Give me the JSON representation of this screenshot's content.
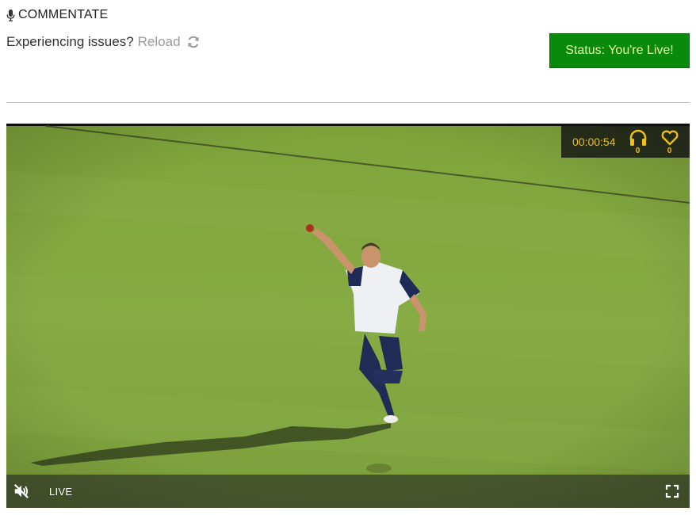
{
  "header": {
    "title": "COMMENTATE",
    "issues_text": "Experiencing issues?",
    "reload_label": "Reload"
  },
  "status": {
    "label": "Status: You're Live!",
    "color": "#0a8a0a"
  },
  "video": {
    "timer": "00:00:54",
    "listeners_count": "0",
    "likes_count": "0",
    "live_label": "LIVE",
    "accent_color": "#f0c010"
  },
  "icons": {
    "mic": "microphone-icon",
    "reload": "refresh-icon",
    "listeners": "headphones-icon",
    "likes": "heart-icon",
    "mute": "volume-muted-icon",
    "fullscreen": "fullscreen-icon"
  }
}
